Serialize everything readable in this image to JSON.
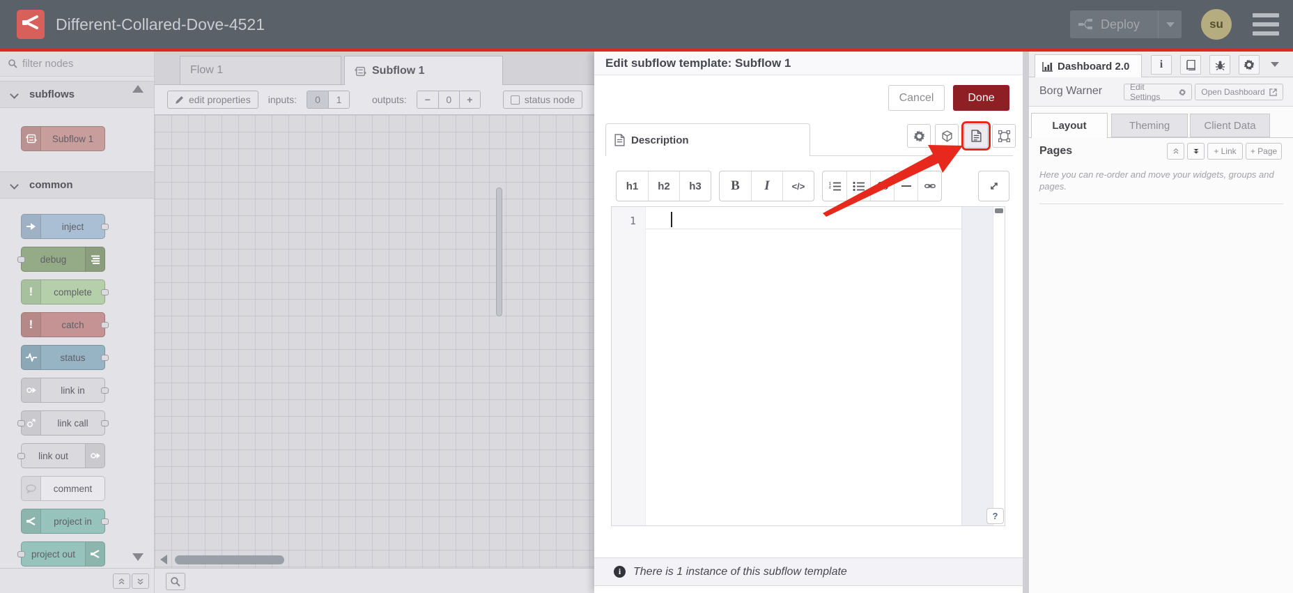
{
  "header": {
    "title": "Different-Collared-Dove-4521",
    "deploy_label": "Deploy",
    "avatar_label": "su"
  },
  "palette": {
    "filter_placeholder": "filter nodes",
    "sections": [
      {
        "label": "subflows",
        "nodes": [
          {
            "label": "Subflow 1",
            "color": "#c79e9c"
          }
        ]
      },
      {
        "label": "common",
        "nodes": [
          {
            "label": "inject",
            "color": "#abbfd4"
          },
          {
            "label": "debug",
            "color": "#95aa87"
          },
          {
            "label": "complete",
            "color": "#b4cfa9"
          },
          {
            "label": "catch",
            "color": "#c59393"
          },
          {
            "label": "status",
            "color": "#97b4c4"
          },
          {
            "label": "link in",
            "color": "#dadade"
          },
          {
            "label": "link call",
            "color": "#dadade"
          },
          {
            "label": "link out",
            "color": "#dadade"
          },
          {
            "label": "comment",
            "color": "#e9e9ed"
          },
          {
            "label": "project in",
            "color": "#96c3bb"
          },
          {
            "label": "project out",
            "color": "#96c3bb"
          }
        ]
      }
    ]
  },
  "workspace": {
    "tabs": [
      {
        "label": "Flow 1",
        "active": false
      },
      {
        "label": "Subflow 1",
        "active": true
      }
    ],
    "toolbar": {
      "edit_properties": "edit properties",
      "inputs_label": "inputs:",
      "input_options": [
        "0",
        "1"
      ],
      "selected_input": "0",
      "outputs_label": "outputs:",
      "outputs_minus": "−",
      "outputs_value": "0",
      "outputs_plus": "+",
      "status_node": "status node"
    }
  },
  "tray": {
    "title": "Edit subflow template: Subflow 1",
    "cancel": "Cancel",
    "done": "Done",
    "tab": "Description",
    "markdown_toolbar": {
      "h1": "h1",
      "h2": "h2",
      "h3": "h3",
      "bold": "B",
      "italic": "I",
      "code": "</>",
      "quote": "66"
    },
    "editor": {
      "line_number": "1"
    },
    "help": "?",
    "footer": "There is 1 instance of this subflow template"
  },
  "sidebar": {
    "tab": "Dashboard 2.0",
    "project": "Borg Warner",
    "edit_settings": "Edit Settings",
    "open_dashboard": "Open Dashboard",
    "tabs": [
      {
        "label": "Layout",
        "active": true
      },
      {
        "label": "Theming",
        "active": false
      },
      {
        "label": "Client Data",
        "active": false
      }
    ],
    "pages_heading": "Pages",
    "add_link": "+ Link",
    "add_page": "+ Page",
    "help_text": "Here you can re-order and move your widgets, groups and pages."
  },
  "colors": {
    "header_bg": "#5b6169",
    "header_underline": "#de2a1e",
    "done_button": "#8e1f24",
    "annotation_arrow": "#e7281d",
    "highlight_border": "#e8281e",
    "avatar_bg": "#b5ad80"
  },
  "icons": {
    "header": [
      "node-red-logo",
      "deploy-icon",
      "menu-icon"
    ],
    "palette": [
      "search-icon",
      "chevron-down-icon",
      "subflow-icon",
      "inject-icon",
      "debug-icon",
      "exclamation-icon",
      "status-pulse-icon",
      "link-icon",
      "comment-icon",
      "project-icon",
      "scroll-up-icon",
      "scroll-down-icon"
    ],
    "workspace": [
      "pencil-icon",
      "checkbox-icon",
      "trash-icon",
      "search-icon"
    ],
    "tray": [
      "description-icon",
      "gear-icon",
      "cube-icon",
      "doc-icon",
      "appearance-icon",
      "ordered-list-icon",
      "unordered-list-icon",
      "quote-icon",
      "hr-icon",
      "link-chain-icon",
      "expand-icon",
      "info-icon"
    ],
    "sidebar": [
      "bar-chart-icon",
      "info-icon",
      "book-icon",
      "bug-icon",
      "gear-icon",
      "chevron-down-icon",
      "external-link-icon",
      "collapse-all-icon",
      "expand-all-icon"
    ]
  }
}
